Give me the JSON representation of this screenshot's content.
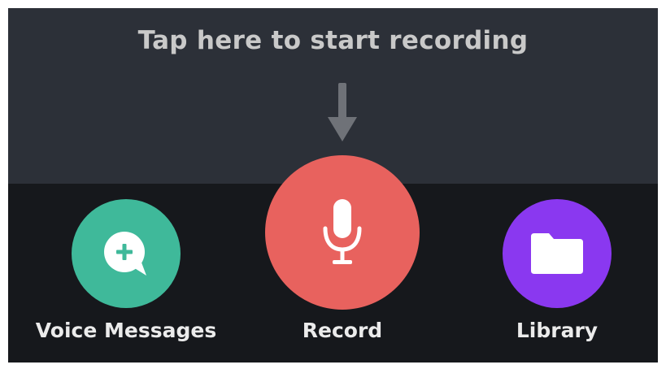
{
  "hint": {
    "text": "Tap here to start recording",
    "arrow_icon": "down-arrow-icon"
  },
  "actions": [
    {
      "id": "voice-messages",
      "label": "Voice Messages",
      "icon": "chat-bubble-plus-icon",
      "color": "#3fb99a"
    },
    {
      "id": "record",
      "label": "Record",
      "icon": "microphone-icon",
      "color": "#e8625e"
    },
    {
      "id": "library",
      "label": "Library",
      "icon": "folder-icon",
      "color": "#8a38f0"
    }
  ],
  "colors": {
    "top_panel": "#2c3038",
    "bottom_panel": "#16181c",
    "hint_text": "#c9c9c9",
    "label_text": "#ebebeb"
  }
}
